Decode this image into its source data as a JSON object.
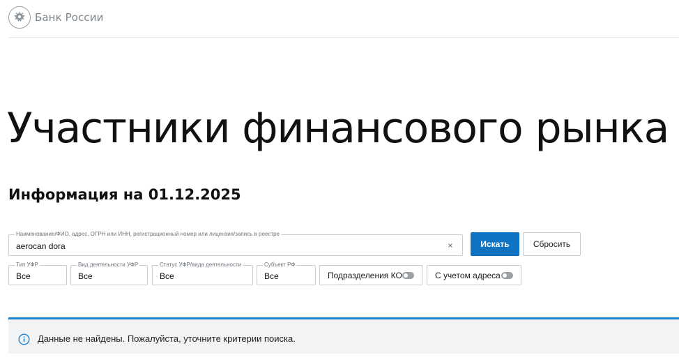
{
  "header": {
    "logo_text": "Банк России"
  },
  "title": "Участники финансового рынка",
  "info_date": "Информация на 01.12.2025",
  "search": {
    "legend": "Наименование/ФИО, адрес, ОГРН или ИНН, регистрационный номер или лицензия/запись в реестре",
    "value": "aerocan dora",
    "clear_symbol": "×",
    "search_label": "Искать",
    "reset_label": "Сбросить"
  },
  "filters": {
    "type": {
      "legend": "Тип УФР",
      "value": "Все"
    },
    "activity": {
      "legend": "Вид деятельности УФР",
      "value": "Все"
    },
    "status": {
      "legend": "Статус УФР/вида деятельности",
      "value": "Все"
    },
    "region": {
      "legend": "Субъект РФ",
      "value": "Все"
    }
  },
  "toggles": {
    "subdivisions": {
      "label": "Подразделения КО",
      "on": false
    },
    "address": {
      "label": "С учетом адреса",
      "on": false
    }
  },
  "alert": {
    "text": "Данные не найдены. Пожалуйста, уточните критерии поиска."
  },
  "colors": {
    "accent": "#0f73c4",
    "alert_border": "#1a86d0",
    "alert_bg": "#f2f3f5"
  }
}
